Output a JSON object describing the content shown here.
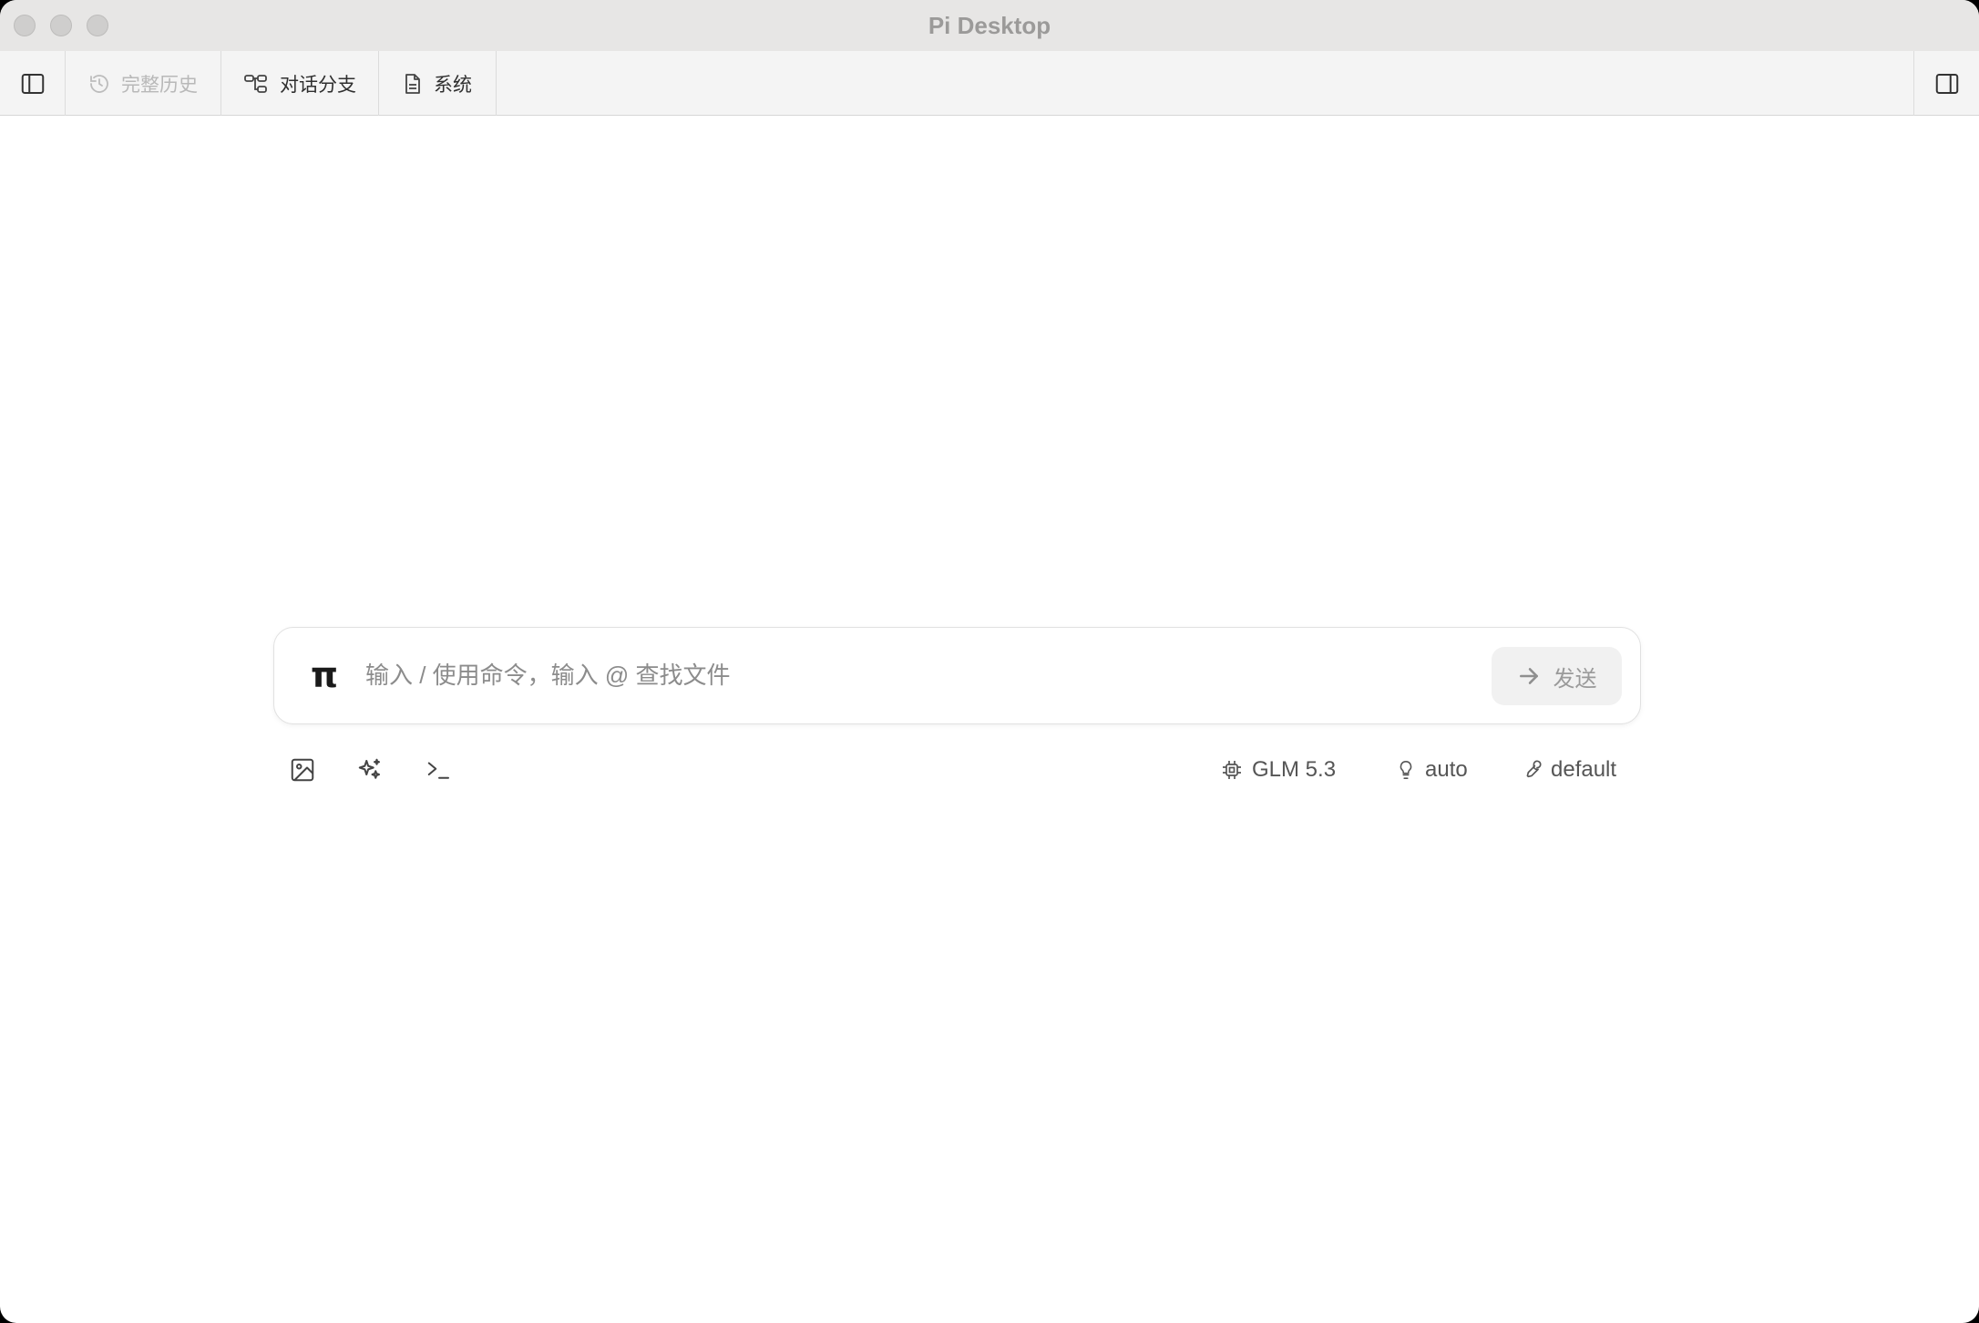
{
  "window": {
    "title": "Pi Desktop"
  },
  "toolbar": {
    "tabs": [
      {
        "label": "完整历史",
        "icon": "history-icon",
        "disabled": true
      },
      {
        "label": "对话分支",
        "icon": "branch-icon",
        "disabled": false
      },
      {
        "label": "系统",
        "icon": "document-icon",
        "disabled": false
      }
    ]
  },
  "composer": {
    "logo": "π",
    "placeholder": "输入 / 使用命令，输入 @ 查找文件",
    "value": "",
    "send_label": "发送"
  },
  "bottom_tools": {
    "icons": [
      "image-icon",
      "sparkle-icon",
      "terminal-icon"
    ],
    "model": "GLM 5.3",
    "thinking": "auto",
    "mode": "default"
  },
  "colors": {
    "background": "#ffffff",
    "toolbar": "#f4f4f4",
    "titlebar": "#e7e6e5"
  }
}
